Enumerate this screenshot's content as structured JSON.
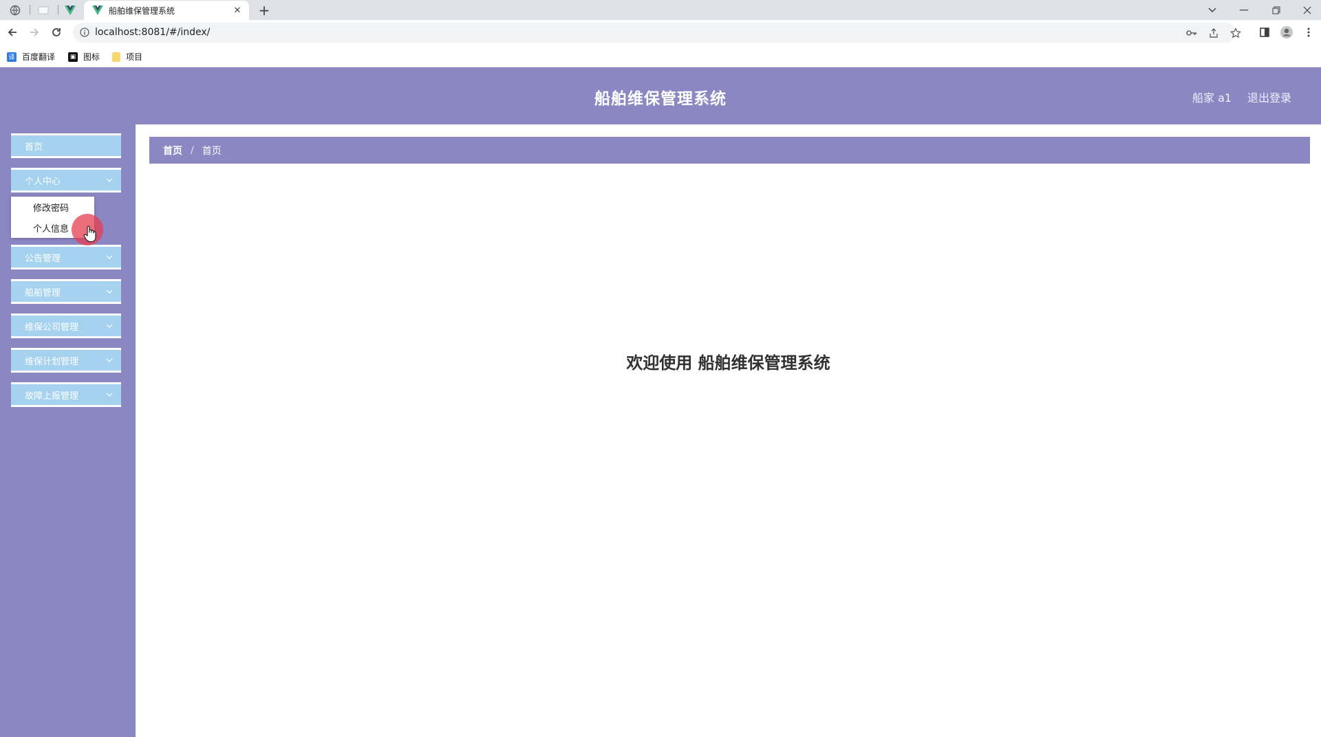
{
  "browser": {
    "active_tab_title": "船舶维保管理系统",
    "url": "localhost:8081/#/index/",
    "bookmarks": [
      "百度翻译",
      "图标",
      "项目"
    ]
  },
  "header": {
    "title": "船舶维保管理系统",
    "user": "船家 a1",
    "logout": "退出登录"
  },
  "sidebar": {
    "items": [
      {
        "label": "首页"
      },
      {
        "label": "个人中心"
      },
      {
        "label": "公告管理"
      },
      {
        "label": "船舶管理"
      },
      {
        "label": "维保公司管理"
      },
      {
        "label": "维保计划管理"
      },
      {
        "label": "故障上报管理"
      }
    ],
    "submenu": [
      "修改密码",
      "个人信息"
    ]
  },
  "breadcrumb": [
    "首页",
    "首页"
  ],
  "breadcrumb_separator": "/",
  "main": {
    "welcome": "欢迎使用 船舶维保管理系统"
  },
  "colors": {
    "primary": "#8a87c3",
    "menu_item": "#a5d2ef"
  }
}
